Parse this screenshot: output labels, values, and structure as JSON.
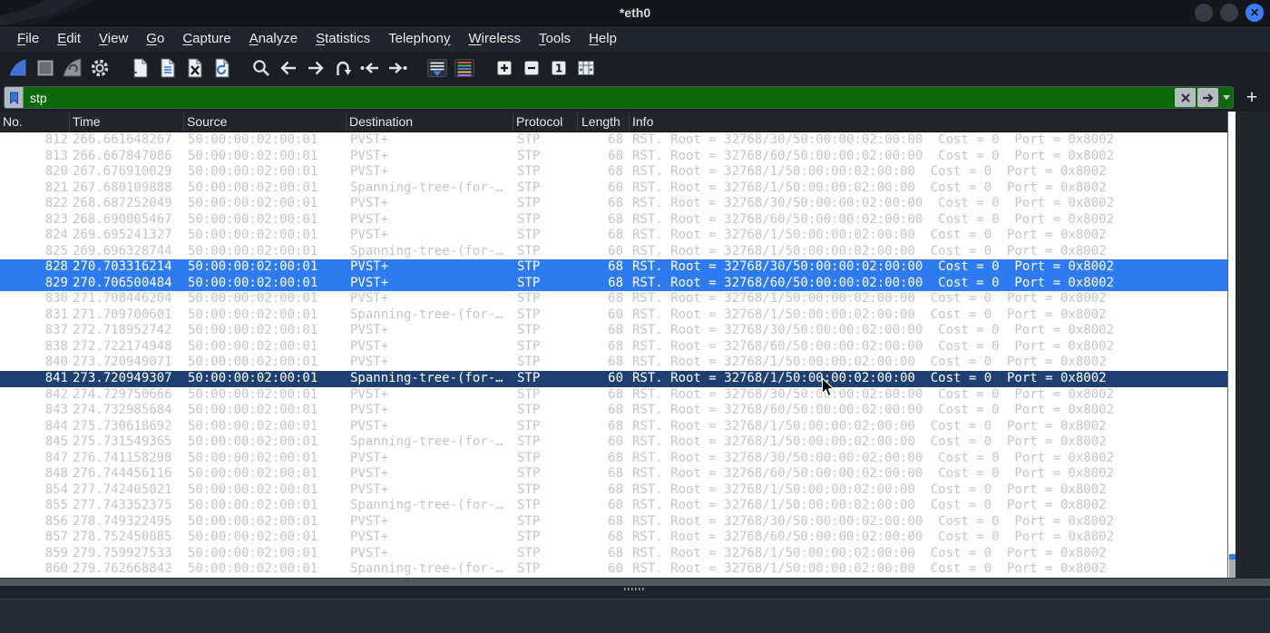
{
  "window": {
    "title": "*eth0"
  },
  "menu_bar": {
    "items": [
      {
        "label": "File",
        "underline": 0
      },
      {
        "label": "Edit",
        "underline": 0
      },
      {
        "label": "View",
        "underline": 0
      },
      {
        "label": "Go",
        "underline": 0
      },
      {
        "label": "Capture",
        "underline": 0
      },
      {
        "label": "Analyze",
        "underline": 0
      },
      {
        "label": "Statistics",
        "underline": 0
      },
      {
        "label": "Telephony",
        "underline": 8
      },
      {
        "label": "Wireless",
        "underline": 0
      },
      {
        "label": "Tools",
        "underline": 0
      },
      {
        "label": "Help",
        "underline": 0
      }
    ]
  },
  "toolbar": {
    "buttons": [
      {
        "name": "capture-start",
        "group": 0
      },
      {
        "name": "capture-stop",
        "group": 0
      },
      {
        "name": "capture-restart",
        "group": 0
      },
      {
        "name": "capture-options",
        "group": 0
      },
      {
        "name": "file-open",
        "group": 1
      },
      {
        "name": "file-save",
        "group": 1
      },
      {
        "name": "file-close",
        "group": 1
      },
      {
        "name": "file-reload",
        "group": 1
      },
      {
        "name": "find-packet",
        "group": 2
      },
      {
        "name": "go-back",
        "group": 2
      },
      {
        "name": "go-forward",
        "group": 2
      },
      {
        "name": "go-to-packet",
        "group": 2
      },
      {
        "name": "go-first",
        "group": 2
      },
      {
        "name": "go-last",
        "group": 2
      },
      {
        "name": "auto-scroll",
        "group": 3
      },
      {
        "name": "colorize",
        "group": 3
      },
      {
        "name": "zoom-in",
        "group": 4
      },
      {
        "name": "zoom-out",
        "group": 4
      },
      {
        "name": "zoom-100",
        "group": 4
      },
      {
        "name": "resize-columns",
        "group": 4
      }
    ]
  },
  "filter_bar": {
    "value": "stp",
    "add_button_label": "+"
  },
  "packet_list": {
    "columns": [
      "No.",
      "Time",
      "Source",
      "Destination",
      "Protocol",
      "Length",
      "Info"
    ],
    "rows": [
      [
        "812",
        "266.661648267",
        "50:00:00:02:00:01",
        "PVST+",
        "STP",
        "68",
        "RST. Root = 32768/30/50:00:00:02:00:00  Cost = 0  Port = 0x8002",
        "normal"
      ],
      [
        "813",
        "266.667847086",
        "50:00:00:02:00:01",
        "PVST+",
        "STP",
        "68",
        "RST. Root = 32768/60/50:00:00:02:00:00  Cost = 0  Port = 0x8002",
        "normal"
      ],
      [
        "820",
        "267.676910029",
        "50:00:00:02:00:01",
        "PVST+",
        "STP",
        "68",
        "RST. Root = 32768/1/50:00:00:02:00:00  Cost = 0  Port = 0x8002",
        "normal"
      ],
      [
        "821",
        "267.680109888",
        "50:00:00:02:00:01",
        "Spanning-tree-(for-…",
        "STP",
        "60",
        "RST. Root = 32768/1/50:00:00:02:00:00  Cost = 0  Port = 0x8002",
        "normal"
      ],
      [
        "822",
        "268.687252049",
        "50:00:00:02:00:01",
        "PVST+",
        "STP",
        "68",
        "RST. Root = 32768/30/50:00:00:02:00:00  Cost = 0  Port = 0x8002",
        "normal"
      ],
      [
        "823",
        "268.690805467",
        "50:00:00:02:00:01",
        "PVST+",
        "STP",
        "68",
        "RST. Root = 32768/60/50:00:00:02:00:00  Cost = 0  Port = 0x8002",
        "normal"
      ],
      [
        "824",
        "269.695241327",
        "50:00:00:02:00:01",
        "PVST+",
        "STP",
        "68",
        "RST. Root = 32768/1/50:00:00:02:00:00  Cost = 0  Port = 0x8002",
        "normal"
      ],
      [
        "825",
        "269.696328744",
        "50:00:00:02:00:01",
        "Spanning-tree-(for-…",
        "STP",
        "60",
        "RST. Root = 32768/1/50:00:00:02:00:00  Cost = 0  Port = 0x8002",
        "normal"
      ],
      [
        "828",
        "270.703316214",
        "50:00:00:02:00:01",
        "PVST+",
        "STP",
        "68",
        "RST. Root = 32768/30/50:00:00:02:00:00  Cost = 0  Port = 0x8002",
        "selected"
      ],
      [
        "829",
        "270.706500484",
        "50:00:00:02:00:01",
        "PVST+",
        "STP",
        "68",
        "RST. Root = 32768/60/50:00:00:02:00:00  Cost = 0  Port = 0x8002",
        "selected"
      ],
      [
        "830",
        "271.708446204",
        "50:00:00:02:00:01",
        "PVST+",
        "STP",
        "68",
        "RST. Root = 32768/1/50:00:00:02:00:00  Cost = 0  Port = 0x8002",
        "normal"
      ],
      [
        "831",
        "271.709700601",
        "50:00:00:02:00:01",
        "Spanning-tree-(for-…",
        "STP",
        "60",
        "RST. Root = 32768/1/50:00:00:02:00:00  Cost = 0  Port = 0x8002",
        "normal"
      ],
      [
        "837",
        "272.718952742",
        "50:00:00:02:00:01",
        "PVST+",
        "STP",
        "68",
        "RST. Root = 32768/30/50:00:00:02:00:00  Cost = 0  Port = 0x8002",
        "normal"
      ],
      [
        "838",
        "272.722174948",
        "50:00:00:02:00:01",
        "PVST+",
        "STP",
        "68",
        "RST. Root = 32768/60/50:00:00:02:00:00  Cost = 0  Port = 0x8002",
        "normal"
      ],
      [
        "840",
        "273.720949071",
        "50:00:00:02:00:01",
        "PVST+",
        "STP",
        "68",
        "RST. Root = 32768/1/50:00:00:02:00:00  Cost = 0  Port = 0x8002",
        "normal"
      ],
      [
        "841",
        "273.720949307",
        "50:00:00:02:00:01",
        "Spanning-tree-(for-…",
        "STP",
        "60",
        "RST. Root = 32768/1/50:00:00:02:00:00  Cost = 0  Port = 0x8002",
        "focused"
      ],
      [
        "842",
        "274.729750666",
        "50:00:00:02:00:01",
        "PVST+",
        "STP",
        "68",
        "RST. Root = 32768/30/50:00:00:02:00:00  Cost = 0  Port = 0x8002",
        "normal"
      ],
      [
        "843",
        "274.732985684",
        "50:00:00:02:00:01",
        "PVST+",
        "STP",
        "68",
        "RST. Root = 32768/60/50:00:00:02:00:00  Cost = 0  Port = 0x8002",
        "normal"
      ],
      [
        "844",
        "275.730618692",
        "50:00:00:02:00:01",
        "PVST+",
        "STP",
        "68",
        "RST. Root = 32768/1/50:00:00:02:00:00  Cost = 0  Port = 0x8002",
        "normal"
      ],
      [
        "845",
        "275.731549365",
        "50:00:00:02:00:01",
        "Spanning-tree-(for-…",
        "STP",
        "60",
        "RST. Root = 32768/1/50:00:00:02:00:00  Cost = 0  Port = 0x8002",
        "normal"
      ],
      [
        "847",
        "276.741158298",
        "50:00:00:02:00:01",
        "PVST+",
        "STP",
        "68",
        "RST. Root = 32768/30/50:00:00:02:00:00  Cost = 0  Port = 0x8002",
        "normal"
      ],
      [
        "848",
        "276.744456116",
        "50:00:00:02:00:01",
        "PVST+",
        "STP",
        "68",
        "RST. Root = 32768/60/50:00:00:02:00:00  Cost = 0  Port = 0x8002",
        "normal"
      ],
      [
        "854",
        "277.742405021",
        "50:00:00:02:00:01",
        "PVST+",
        "STP",
        "68",
        "RST. Root = 32768/1/50:00:00:02:00:00  Cost = 0  Port = 0x8002",
        "normal"
      ],
      [
        "855",
        "277.743352375",
        "50:00:00:02:00:01",
        "Spanning-tree-(for-…",
        "STP",
        "60",
        "RST. Root = 32768/1/50:00:00:02:00:00  Cost = 0  Port = 0x8002",
        "normal"
      ],
      [
        "856",
        "278.749322495",
        "50:00:00:02:00:01",
        "PVST+",
        "STP",
        "68",
        "RST. Root = 32768/30/50:00:00:02:00:00  Cost = 0  Port = 0x8002",
        "normal"
      ],
      [
        "857",
        "278.752450885",
        "50:00:00:02:00:01",
        "PVST+",
        "STP",
        "68",
        "RST. Root = 32768/60/50:00:00:02:00:00  Cost = 0  Port = 0x8002",
        "normal"
      ],
      [
        "859",
        "279.759927533",
        "50:00:00:02:00:01",
        "PVST+",
        "STP",
        "68",
        "RST. Root = 32768/1/50:00:00:02:00:00  Cost = 0  Port = 0x8002",
        "normal"
      ],
      [
        "860",
        "279.762668842",
        "50:00:00:02:00:01",
        "Spanning-tree-(for-…",
        "STP",
        "60",
        "RST. Root = 32768/1/50:00:00:02:00:00  Cost = 0  Port = 0x8002",
        "normal"
      ]
    ]
  },
  "colors": {
    "selected_row": "#2e7bf1",
    "focused_row": "#1d3f72",
    "filter_valid_bg": "#0a6a0a",
    "accent_blue": "#3b7ef2"
  }
}
